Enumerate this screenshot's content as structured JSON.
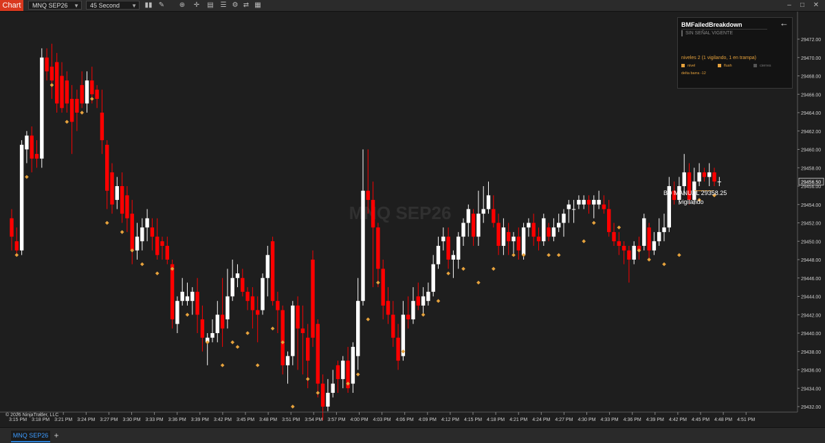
{
  "toolbar": {
    "chart_button": "Chart",
    "instrument": "MNQ SEP26",
    "interval": "45 Second",
    "icons": [
      "bar-type-icon",
      "draw-tools-icon",
      "zoom-icon",
      "crosshair-icon",
      "data-box-icon",
      "properties-icon",
      "strategies-icon",
      "indicators-icon",
      "pin-icon"
    ],
    "window_icons": [
      "minimize-icon",
      "maximize-icon",
      "close-icon"
    ]
  },
  "chart": {
    "watermark": "MNQ SEP26",
    "copyright": "© 2026 NinjaTrader, LLC",
    "colors": {
      "up": "#ffffff",
      "down": "#ff0000",
      "marker": "#e6a23c",
      "background": "#1e1e1e"
    },
    "current_price_label": "29456.50",
    "labels": {
      "bd_manual": "BD MANUAL 29358.25",
      "status": "vigilando"
    }
  },
  "chart_data": {
    "type": "candlestick",
    "y_ticks": [
      "29472.00",
      "29470.00",
      "29468.00",
      "29466.00",
      "29464.00",
      "29462.00",
      "29460.00",
      "29458.00",
      "29456.00",
      "29454.00",
      "29452.00",
      "29450.00",
      "29448.00",
      "29446.00",
      "29444.00",
      "29442.00",
      "29440.00",
      "29438.00",
      "29436.00",
      "29434.00",
      "29432.00"
    ],
    "x_ticks": [
      "3:15 PM",
      "3:18 PM",
      "3:21 PM",
      "3:24 PM",
      "3:27 PM",
      "3:30 PM",
      "3:33 PM",
      "3:36 PM",
      "3:39 PM",
      "3:42 PM",
      "3:45 PM",
      "3:48 PM",
      "3:51 PM",
      "3:54 PM",
      "3:57 PM",
      "4:00 PM",
      "4:03 PM",
      "4:06 PM",
      "4:09 PM",
      "4:12 PM",
      "4:15 PM",
      "4:18 PM",
      "4:21 PM",
      "4:24 PM",
      "4:27 PM",
      "4:30 PM",
      "4:33 PM",
      "4:36 PM",
      "4:39 PM",
      "4:42 PM",
      "4:45 PM",
      "4:48 PM",
      "4:51 PM"
    ],
    "ylim": [
      29430.5,
      29474.0
    ],
    "current_price": 29456.5,
    "candles": [
      [
        29452.5,
        29450.5,
        29453.5,
        29449.0
      ],
      [
        29450.0,
        29449.0,
        29451.5,
        29448.5
      ],
      [
        29449.0,
        29460.5,
        29461.0,
        29448.5
      ],
      [
        29460.0,
        29461.5,
        29462.0,
        29458.5
      ],
      [
        29461.5,
        29459.0,
        29462.5,
        29457.5
      ],
      [
        29459.5,
        29459.0,
        29461.0,
        29458.0
      ],
      [
        29459.0,
        29470.0,
        29471.0,
        29458.0
      ],
      [
        29470.0,
        29468.5,
        29471.0,
        29467.5
      ],
      [
        29469.0,
        29467.5,
        29471.5,
        29465.5
      ],
      [
        29469.5,
        29465.0,
        29470.5,
        29464.0
      ],
      [
        29468.0,
        29464.5,
        29469.5,
        29464.0
      ],
      [
        29467.5,
        29465.0,
        29468.5,
        29464.0
      ],
      [
        29465.5,
        29463.0,
        29467.0,
        29459.5
      ],
      [
        29465.5,
        29464.0,
        29466.5,
        29462.0
      ],
      [
        29467.0,
        29465.0,
        29468.5,
        29464.5
      ],
      [
        29465.0,
        29467.5,
        29468.5,
        29464.0
      ],
      [
        29467.5,
        29466.0,
        29469.0,
        29465.0
      ],
      [
        29466.5,
        29465.5,
        29467.0,
        29464.5
      ],
      [
        29464.0,
        29461.0,
        29466.5,
        29459.5
      ],
      [
        29460.5,
        29455.5,
        29461.0,
        29453.5
      ],
      [
        29457.5,
        29454.0,
        29458.5,
        29453.0
      ],
      [
        29454.5,
        29456.0,
        29457.0,
        29453.5
      ],
      [
        29456.0,
        29453.0,
        29457.5,
        29452.0
      ],
      [
        29455.0,
        29452.5,
        29456.0,
        29451.0
      ],
      [
        29453.0,
        29449.0,
        29454.5,
        29447.5
      ],
      [
        29449.0,
        29450.5,
        29452.0,
        29448.0
      ],
      [
        29450.0,
        29451.5,
        29452.5,
        29449.0
      ],
      [
        29451.5,
        29452.5,
        29453.5,
        29450.0
      ],
      [
        29451.5,
        29450.5,
        29452.5,
        29449.0
      ],
      [
        29450.5,
        29448.5,
        29452.5,
        29448.0
      ],
      [
        29450.0,
        29449.5,
        29450.5,
        29448.0
      ],
      [
        29449.5,
        29448.0,
        29450.5,
        29447.5
      ],
      [
        29447.5,
        29441.5,
        29448.0,
        29440.5
      ],
      [
        29441.0,
        29443.5,
        29444.0,
        29440.0
      ],
      [
        29443.5,
        29444.5,
        29446.0,
        29443.0
      ],
      [
        29443.5,
        29444.0,
        29445.5,
        29443.0
      ],
      [
        29443.5,
        29444.5,
        29445.0,
        29442.0
      ],
      [
        29444.5,
        29442.0,
        29446.0,
        29440.0
      ],
      [
        29441.5,
        29439.5,
        29443.0,
        29438.0
      ],
      [
        29439.0,
        29439.5,
        29440.0,
        29436.5
      ],
      [
        29439.5,
        29440.0,
        29441.5,
        29439.0
      ],
      [
        29440.0,
        29442.0,
        29443.5,
        29439.0
      ],
      [
        29442.0,
        29440.5,
        29446.0,
        29438.5
      ],
      [
        29441.5,
        29444.0,
        29447.0,
        29440.5
      ],
      [
        29444.0,
        29446.0,
        29448.0,
        29443.5
      ],
      [
        29446.0,
        29446.5,
        29447.5,
        29445.0
      ],
      [
        29446.0,
        29444.5,
        29447.0,
        29444.0
      ],
      [
        29444.5,
        29443.5,
        29445.0,
        29442.5
      ],
      [
        29444.0,
        29442.5,
        29445.0,
        29440.5
      ],
      [
        29442.5,
        29442.0,
        29444.0,
        29439.0
      ],
      [
        29442.5,
        29446.0,
        29446.5,
        29442.0
      ],
      [
        29446.0,
        29448.5,
        29449.5,
        29444.0
      ],
      [
        29450.0,
        29443.5,
        29450.5,
        29443.0
      ],
      [
        29443.5,
        29442.5,
        29444.5,
        29440.0
      ],
      [
        29442.5,
        29436.5,
        29443.0,
        29435.5
      ],
      [
        29436.5,
        29437.5,
        29438.0,
        29434.5
      ],
      [
        29437.5,
        29443.0,
        29443.5,
        29436.5
      ],
      [
        29443.0,
        29440.5,
        29444.0,
        29436.0
      ],
      [
        29440.5,
        29440.0,
        29443.0,
        29435.5
      ],
      [
        29439.5,
        29437.0,
        29441.0,
        29434.0
      ],
      [
        29448.0,
        29439.5,
        29449.0,
        29438.5
      ],
      [
        29441.0,
        29434.5,
        29441.5,
        29433.0
      ],
      [
        29434.5,
        29432.0,
        29435.5,
        29430.5
      ],
      [
        29432.0,
        29433.5,
        29435.0,
        29431.5
      ],
      [
        29433.5,
        29434.5,
        29436.0,
        29433.0
      ],
      [
        29436.5,
        29435.0,
        29437.0,
        29433.5
      ],
      [
        29435.0,
        29437.0,
        29437.5,
        29434.0
      ],
      [
        29437.0,
        29434.0,
        29438.5,
        29433.5
      ],
      [
        29434.5,
        29438.5,
        29439.0,
        29433.5
      ],
      [
        29437.5,
        29443.5,
        29446.0,
        29436.0
      ],
      [
        29443.5,
        29455.5,
        29460.0,
        29443.0
      ],
      [
        29455.5,
        29454.5,
        29460.0,
        29453.0
      ],
      [
        29454.5,
        29451.5,
        29456.5,
        29445.0
      ],
      [
        29451.5,
        29447.0,
        29452.0,
        29445.0
      ],
      [
        29447.0,
        29443.0,
        29448.0,
        29441.5
      ],
      [
        29443.5,
        29442.0,
        29445.0,
        29441.0
      ],
      [
        29442.0,
        29439.5,
        29443.5,
        29438.5
      ],
      [
        29439.5,
        29437.0,
        29441.0,
        29436.0
      ],
      [
        29437.5,
        29442.0,
        29443.5,
        29437.0
      ],
      [
        29442.0,
        29441.5,
        29444.0,
        29440.5
      ],
      [
        29441.5,
        29443.5,
        29445.0,
        29441.0
      ],
      [
        29444.0,
        29443.0,
        29445.5,
        29442.5
      ],
      [
        29443.0,
        29444.0,
        29445.0,
        29442.0
      ],
      [
        29443.5,
        29444.5,
        29445.5,
        29443.0
      ],
      [
        29444.5,
        29447.5,
        29448.5,
        29444.0
      ],
      [
        29447.5,
        29449.5,
        29450.5,
        29447.0
      ],
      [
        29450.0,
        29450.5,
        29451.5,
        29449.0
      ],
      [
        29450.5,
        29448.0,
        29451.5,
        29447.0
      ],
      [
        29448.0,
        29448.5,
        29449.0,
        29446.0
      ],
      [
        29448.0,
        29450.5,
        29451.0,
        29447.0
      ],
      [
        29450.5,
        29452.0,
        29452.5,
        29449.5
      ],
      [
        29452.0,
        29453.5,
        29454.0,
        29450.5
      ],
      [
        29453.0,
        29450.5,
        29453.5,
        29449.5
      ],
      [
        29450.5,
        29453.0,
        29455.5,
        29449.5
      ],
      [
        29453.0,
        29453.5,
        29456.0,
        29452.0
      ],
      [
        29453.5,
        29455.0,
        29456.5,
        29453.0
      ],
      [
        29453.5,
        29452.0,
        29455.0,
        29451.5
      ],
      [
        29452.0,
        29449.5,
        29453.0,
        29448.5
      ],
      [
        29449.5,
        29451.5,
        29452.5,
        29448.5
      ],
      [
        29451.0,
        29450.0,
        29452.0,
        29448.5
      ],
      [
        29450.0,
        29450.5,
        29451.0,
        29448.5
      ],
      [
        29450.5,
        29449.0,
        29451.5,
        29448.0
      ],
      [
        29448.5,
        29451.5,
        29452.0,
        29448.0
      ],
      [
        29451.5,
        29452.0,
        29452.5,
        29450.5
      ],
      [
        29452.0,
        29450.5,
        29453.0,
        29449.5
      ],
      [
        29450.5,
        29450.0,
        29451.5,
        29449.0
      ],
      [
        29450.0,
        29452.5,
        29453.0,
        29449.5
      ],
      [
        29451.5,
        29450.5,
        29452.0,
        29450.0
      ],
      [
        29450.5,
        29451.5,
        29452.5,
        29450.0
      ],
      [
        29451.5,
        29452.0,
        29453.0,
        29451.0
      ],
      [
        29452.0,
        29453.0,
        29453.5,
        29450.5
      ],
      [
        29453.5,
        29454.0,
        29454.5,
        29452.0
      ],
      [
        29453.5,
        29453.5,
        29454.5,
        29452.0
      ],
      [
        29454.0,
        29454.5,
        29455.0,
        29453.5
      ],
      [
        29454.0,
        29454.5,
        29455.0,
        29453.5
      ],
      [
        29454.5,
        29454.0,
        29455.0,
        29453.0
      ],
      [
        29454.0,
        29454.5,
        29455.0,
        29452.5
      ],
      [
        29454.0,
        29454.5,
        29455.5,
        29453.5
      ],
      [
        29454.0,
        29453.5,
        29455.0,
        29453.0
      ],
      [
        29453.5,
        29451.0,
        29454.5,
        29450.5
      ],
      [
        29451.0,
        29450.0,
        29452.0,
        29449.5
      ],
      [
        29450.0,
        29449.5,
        29451.0,
        29448.5
      ],
      [
        29449.5,
        29449.0,
        29450.0,
        29447.5
      ],
      [
        29449.0,
        29448.0,
        29449.5,
        29445.5
      ],
      [
        29448.0,
        29449.5,
        29450.0,
        29447.5
      ],
      [
        29449.5,
        29449.0,
        29450.5,
        29448.0
      ],
      [
        29449.5,
        29452.5,
        29453.0,
        29449.0
      ],
      [
        29451.5,
        29449.0,
        29452.0,
        29448.0
      ],
      [
        29449.0,
        29450.0,
        29451.0,
        29448.5
      ],
      [
        29450.0,
        29451.0,
        29452.5,
        29449.5
      ],
      [
        29451.0,
        29451.5,
        29453.0,
        29450.0
      ],
      [
        29451.5,
        29456.0,
        29457.0,
        29451.0
      ],
      [
        29455.5,
        29454.5,
        29456.5,
        29454.0
      ],
      [
        29454.5,
        29456.0,
        29457.0,
        29454.0
      ],
      [
        29456.0,
        29457.5,
        29459.5,
        29455.0
      ],
      [
        29457.5,
        29454.5,
        29458.5,
        29454.0
      ],
      [
        29454.5,
        29456.5,
        29458.0,
        29454.0
      ],
      [
        29456.5,
        29457.5,
        29458.5,
        29456.0
      ],
      [
        29457.5,
        29457.0,
        29458.0,
        29456.5
      ],
      [
        29457.0,
        29457.5,
        29458.5,
        29456.0
      ],
      [
        29457.5,
        29456.5,
        29458.0,
        29456.0
      ],
      [
        29456.5,
        29456.5,
        29457.0,
        29456.0
      ]
    ],
    "markers": [
      [
        1,
        29448.5
      ],
      [
        3,
        29457.0
      ],
      [
        8,
        29467.0
      ],
      [
        11,
        29463.0
      ],
      [
        14,
        29464.0
      ],
      [
        16,
        29465.5
      ],
      [
        19,
        29452.0
      ],
      [
        22,
        29451.0
      ],
      [
        24,
        29449.0
      ],
      [
        26,
        29447.5
      ],
      [
        29,
        29446.5
      ],
      [
        32,
        29447.0
      ],
      [
        35,
        29442.0
      ],
      [
        39,
        29439.0
      ],
      [
        42,
        29436.5
      ],
      [
        44,
        29439.0
      ],
      [
        45,
        29438.5
      ],
      [
        47,
        29440.0
      ],
      [
        49,
        29436.5
      ],
      [
        52,
        29440.5
      ],
      [
        54,
        29439.0
      ],
      [
        56,
        29432.0
      ],
      [
        59,
        29435.0
      ],
      [
        61,
        29433.5
      ],
      [
        67,
        29434.5
      ],
      [
        69,
        29435.5
      ],
      [
        71,
        29441.5
      ],
      [
        73,
        29445.5
      ],
      [
        78,
        29438.0
      ],
      [
        82,
        29442.0
      ],
      [
        85,
        29443.5
      ],
      [
        87,
        29446.5
      ],
      [
        90,
        29447.0
      ],
      [
        93,
        29445.5
      ],
      [
        96,
        29447.0
      ],
      [
        100,
        29448.5
      ],
      [
        102,
        29448.5
      ],
      [
        107,
        29448.5
      ],
      [
        109,
        29448.5
      ],
      [
        114,
        29450.0
      ],
      [
        116,
        29452.0
      ],
      [
        121,
        29451.5
      ],
      [
        125,
        29449.0
      ],
      [
        127,
        29448.0
      ],
      [
        130,
        29447.5
      ],
      [
        133,
        29448.5
      ],
      [
        137,
        29454.5
      ],
      [
        140,
        29455.0
      ]
    ],
    "bd_manual_level": 29455.5
  },
  "panel": {
    "title": "BMFailedBreakdown",
    "signal": "SIN SEÑAL VIGENTE",
    "niveles": "niveles  2   (1 vigilando, 1 en trampa)",
    "legend": [
      {
        "label": "nivel",
        "color": "#e6a23c"
      },
      {
        "label": "flush",
        "color": "#e6a23c"
      },
      {
        "label": "cierres",
        "color": "#555555"
      }
    ],
    "delta": "delta barra  -12",
    "back_icon": "arrow-left-icon"
  },
  "bottom_bar": {
    "tab": "MNQ SEP26",
    "add": "+"
  }
}
